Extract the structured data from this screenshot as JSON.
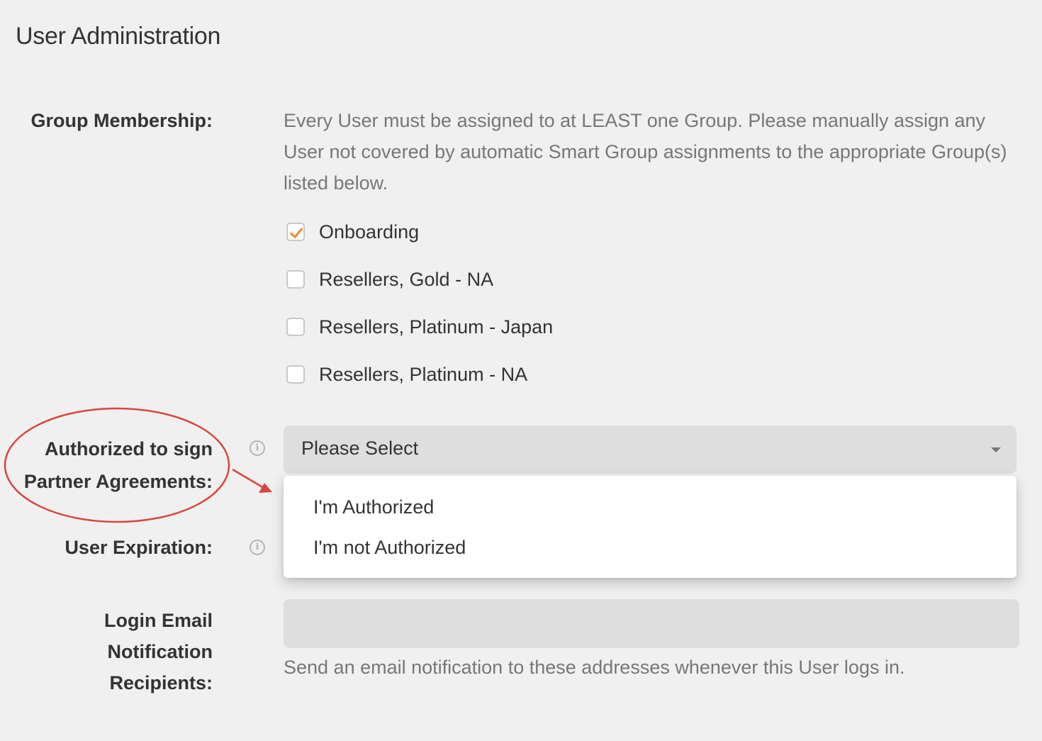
{
  "page": {
    "title": "User Administration"
  },
  "group_membership": {
    "label": "Group Membership:",
    "description": "Every User must be assigned to at LEAST one Group. Please manually assign any User not covered by automatic Smart Group assignments to the appropriate Group(s) listed below.",
    "groups": [
      {
        "label": "Onboarding",
        "checked": true
      },
      {
        "label": "Resellers, Gold - NA",
        "checked": false
      },
      {
        "label": "Resellers, Platinum - Japan",
        "checked": false
      },
      {
        "label": "Resellers, Platinum - NA",
        "checked": false
      }
    ]
  },
  "authorized": {
    "label_line1": "Authorized to sign",
    "label_line2": "Partner Agreements:",
    "select_value": "Please Select",
    "options": [
      "I'm Authorized",
      "I'm not Authorized"
    ]
  },
  "expiration": {
    "label": "User Expiration:"
  },
  "login_email": {
    "label_line1": "Login Email",
    "label_line2": "Notification",
    "label_line3": "Recipients:",
    "value": "",
    "help": "Send an email notification to these addresses whenever this User logs in."
  },
  "colors": {
    "accent": "#f08a24",
    "annotation": "#d9473a",
    "background": "#f0f0f0",
    "field": "#dedede"
  },
  "icons": {
    "info": "info-icon",
    "check": "check-icon",
    "caret": "caret-down-icon"
  }
}
